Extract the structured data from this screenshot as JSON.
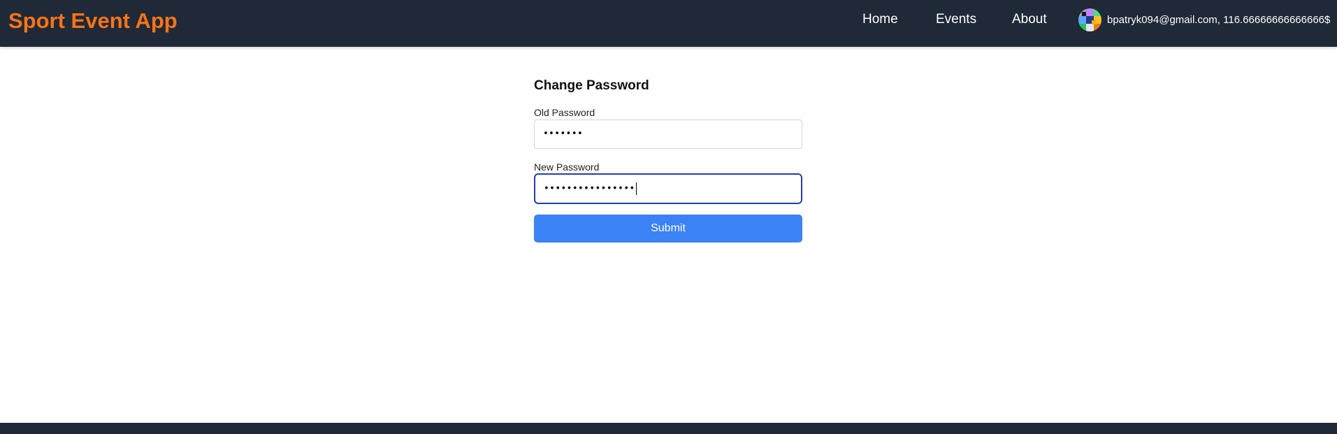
{
  "navbar": {
    "brand": "Sport Event App",
    "links": [
      "Home",
      "Events",
      "About"
    ],
    "user_info": "bpatryk094@gmail.com, 116.66666666666666$",
    "avatar_icon": "user-avatar-icon"
  },
  "form": {
    "title": "Change Password",
    "old_password_label": "Old Password",
    "old_password_value": "•••••••",
    "new_password_label": "New Password",
    "new_password_value": "••••••••••••••••",
    "submit_label": "Submit"
  },
  "colors": {
    "navbar_bg": "#1f2937",
    "brand": "#f97316",
    "button": "#3b82f6",
    "focus_border": "#1e40af"
  }
}
